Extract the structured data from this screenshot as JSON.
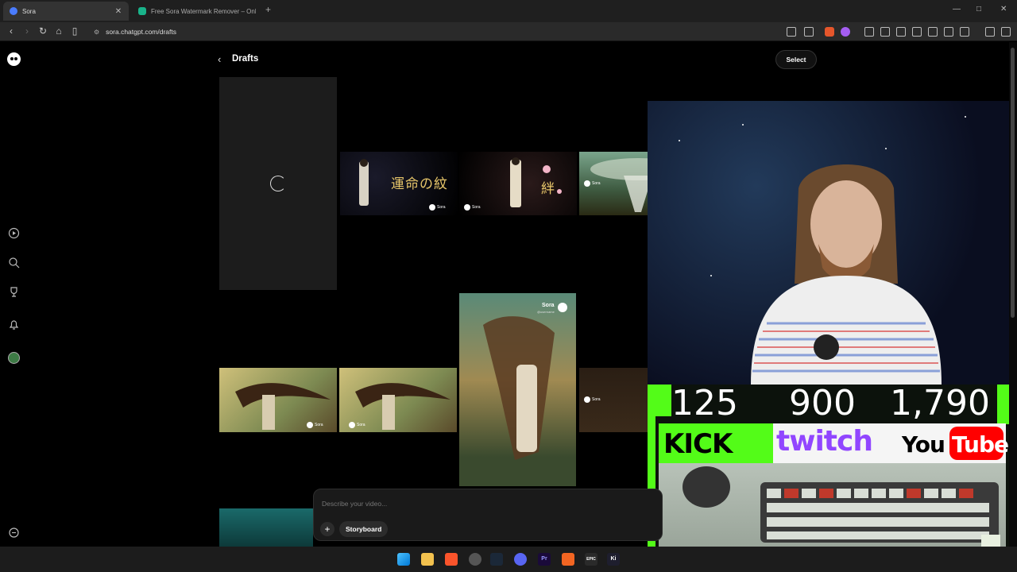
{
  "browser": {
    "tabs": [
      {
        "title": "Sora",
        "active": true
      },
      {
        "title": "Free Sora Watermark Remover – Onl",
        "active": false
      }
    ],
    "new_tab_label": "+",
    "url": "sora.chatgpt.com/drafts",
    "window_controls": [
      "—",
      "□",
      "✕"
    ]
  },
  "page": {
    "title": "Drafts",
    "select_label": "Select",
    "back_glyph": "‹"
  },
  "sidebar": {
    "items": [
      {
        "name": "sora-logo"
      },
      {
        "name": "explore-icon"
      },
      {
        "name": "search-icon"
      },
      {
        "name": "trophy-icon"
      },
      {
        "name": "bell-icon"
      },
      {
        "name": "profile-avatar"
      },
      {
        "name": "more-icon"
      }
    ]
  },
  "drafts": {
    "kanji_1": "運命の紋",
    "kanji_2": "絆",
    "watermark_text": "Sora",
    "watermark_handle": "@username"
  },
  "composer": {
    "placeholder": "Describe your video...",
    "plus_label": "+",
    "storyboard_label": "Storyboard"
  },
  "stream_overlay": {
    "counts": [
      "125",
      "900",
      "1,790"
    ],
    "brands": [
      "KICK",
      "twitch",
      "You",
      "Tube"
    ]
  },
  "taskbar": {
    "icons": [
      "windows-start-icon",
      "file-explorer-icon",
      "brave-icon",
      "chrome-icon",
      "steam-icon",
      "discord-icon",
      "premiere-icon",
      "foxit-icon",
      "epic-games-icon",
      "kite-icon"
    ],
    "labels": {
      "premiere": "Pr",
      "epic": "EPIC",
      "ki": "Ki"
    }
  },
  "colors": {
    "kick_green": "#53fc18",
    "twitch_purple": "#9146ff",
    "youtube_red": "#ff0000",
    "background": "#000000"
  }
}
